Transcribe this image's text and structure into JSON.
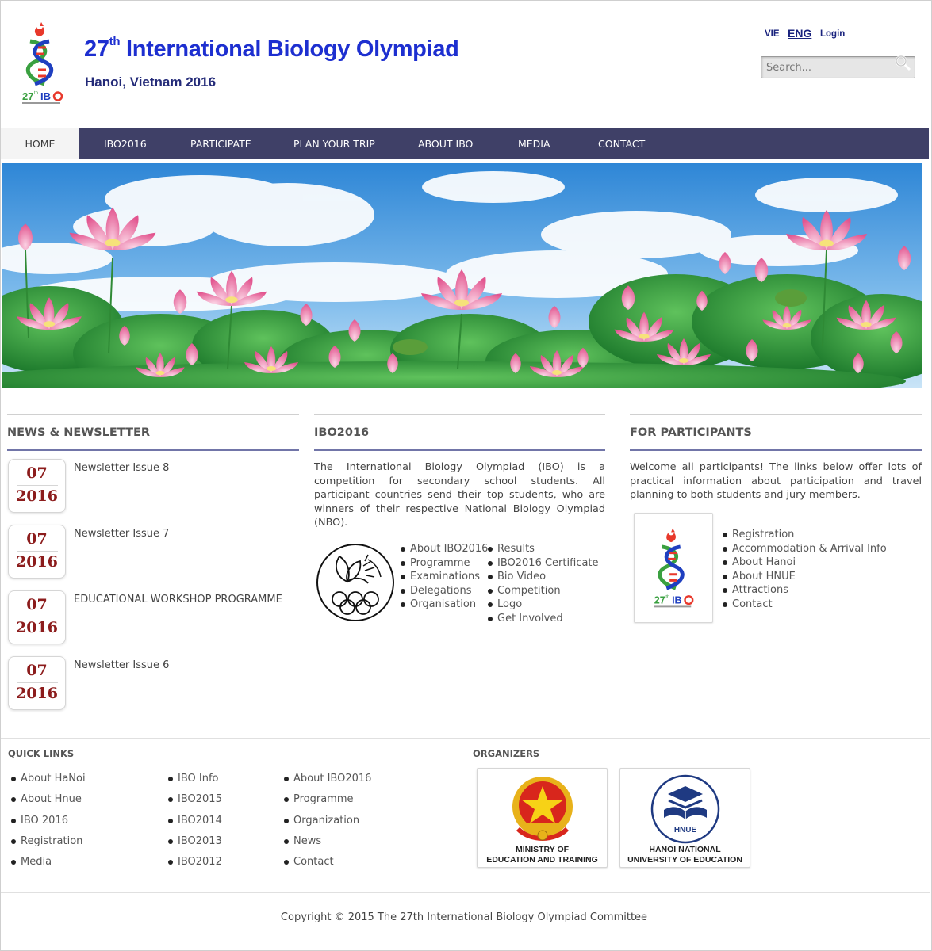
{
  "header": {
    "title_number": "27",
    "title_sup": "th",
    "title_text": "International Biology Olympiad",
    "subtitle": "Hanoi, Vietnam 2016",
    "logo_text": "27thIBO",
    "lang_vie": "VIE",
    "lang_eng": "ENG",
    "login": "Login",
    "search_placeholder": "Search..."
  },
  "nav": [
    "HOME",
    "IBO2016",
    "PARTICIPATE",
    "PLAN YOUR TRIP",
    "ABOUT IBO",
    "MEDIA",
    "CONTACT"
  ],
  "news": {
    "title": "NEWS & NEWSLETTER",
    "items": [
      {
        "month": "07",
        "year": "2016",
        "title": "Newsletter Issue 8"
      },
      {
        "month": "07",
        "year": "2016",
        "title": "Newsletter Issue 7"
      },
      {
        "month": "07",
        "year": "2016",
        "title": "EDUCATIONAL WORKSHOP PROGRAMME"
      },
      {
        "month": "07",
        "year": "2016",
        "title": "Newsletter Issue 6"
      }
    ]
  },
  "ibo2016": {
    "title": "IBO2016",
    "text": "The International Biology Olympiad (IBO) is a competition for secondary school students. All participant countries send their top students, who are winners of their respective National Biology Olympiad (NBO).",
    "links_left": [
      "About IBO2016",
      "Programme",
      "Examinations",
      "Delegations",
      "Organisation"
    ],
    "links_right": [
      "Results",
      "IBO2016 Certificate",
      "Bio Video",
      "Competition",
      "Logo",
      "Get Involved"
    ]
  },
  "participants": {
    "title": "FOR PARTICIPANTS",
    "text": "Welcome all participants! The links below offer lots of practical information about participation and travel planning to both students and jury members.",
    "links": [
      "Registration",
      "Accommodation & Arrival Info",
      "About Hanoi",
      "About HNUE",
      "Attractions",
      "Contact"
    ]
  },
  "footer": {
    "quick_links_title": "QUICK LINKS",
    "col1": [
      "About HaNoi",
      "About Hnue",
      "IBO 2016",
      "Registration",
      "Media"
    ],
    "col2": [
      "IBO Info",
      "IBO2015",
      "IBO2014",
      "IBO2013",
      "IBO2012"
    ],
    "col3": [
      "About IBO2016",
      "Programme",
      "Organization",
      "News",
      "Contact"
    ],
    "organizers_title": "ORGANIZERS",
    "org1_line1": "MINISTRY OF",
    "org1_line2": "EDUCATION AND TRAINING",
    "org2_line1": "HANOI NATIONAL",
    "org2_line2": "UNIVERSITY OF EDUCATION",
    "org2_badge": "HNUE",
    "copyright": "Copyright © 2015 The 27th International Biology Olympiad Committee"
  },
  "colors": {
    "nav_bg": "#3f4067",
    "title_blue": "#1d2fd0",
    "date_red": "#8c1c1c",
    "rule_accent": "#7175a8"
  }
}
